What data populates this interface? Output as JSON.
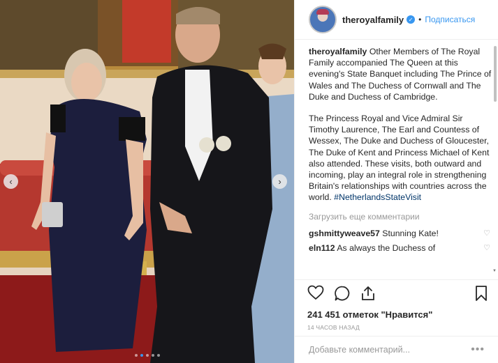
{
  "post": {
    "account_name": "theroyalfamily",
    "separator": "•",
    "follow_label": "Подписаться",
    "caption_user": "theroyalfamily",
    "caption_paragraph_1": "Other Members of The Royal Family accompanied The Queen at this evening's State Banquet including The Prince of Wales and The Duchess of Cornwall and The Duke and Duchess of Cambridge.",
    "caption_paragraph_2": "The Princess Royal and Vice Admiral Sir Timothy Laurence, The Earl and Countess of Wessex, The Duke and Duchess of Gloucester, The Duke of Kent and Princess Michael of Kent also attended. These visits, both outward and incoming, play an integral role in strengthening Britain's relationships with countries across the world.",
    "hashtag": "#NetherlandsStateVisit",
    "load_more_label": "Загрузить еще комментарии",
    "comments": [
      {
        "user": "gshmittyweave57",
        "text": "Stunning Kate!"
      },
      {
        "user": "eln112",
        "text": "As always the Duchess of"
      }
    ],
    "likes_text": "241 451 отметок \"Нравится\"",
    "timestamp": "14 ЧАСОВ НАЗАД",
    "add_comment_placeholder": "Добавьте комментарий...",
    "more_options": "•••"
  },
  "carousel": {
    "prev_glyph": "‹",
    "next_glyph": "›",
    "slide_count": 5,
    "active_slide": 2
  },
  "icons": {
    "verified": "verified-badge-icon",
    "like": "heart-icon",
    "comment": "comment-bubble-icon",
    "share": "share-icon",
    "save": "bookmark-icon"
  },
  "colors": {
    "link_blue": "#3897f0",
    "hashtag": "#003569",
    "muted_text": "#999999"
  }
}
